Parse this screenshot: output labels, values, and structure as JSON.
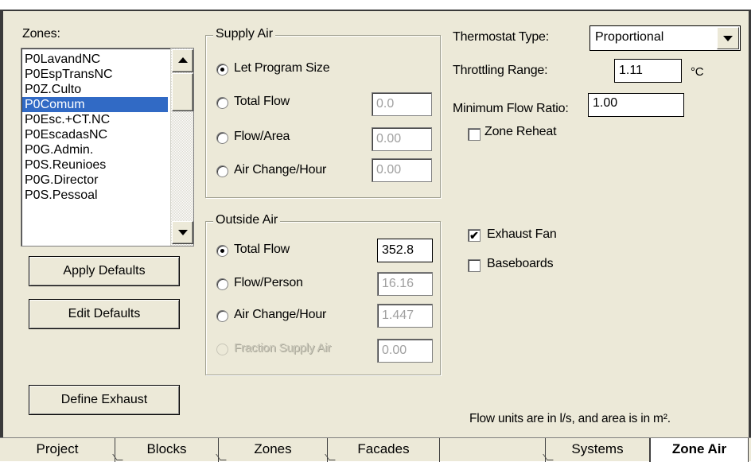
{
  "zones": {
    "label": "Zones:",
    "items": [
      "P0LavandNC",
      "P0EspTransNC",
      "P0Z.Culto",
      "P0Comum",
      "P0Esc.+CT.NC",
      "P0EscadasNC",
      "P0G.Admin.",
      "P0S.Reunioes",
      "P0G.Director",
      "P0S.Pessoal"
    ],
    "selected": "P0Comum"
  },
  "buttons": {
    "apply_defaults": "Apply Defaults",
    "edit_defaults": "Edit Defaults",
    "define_exhaust": "Define Exhaust"
  },
  "supply_air": {
    "title": "Supply Air",
    "let_program_size": "Let Program Size",
    "total_flow": "Total Flow",
    "total_flow_value": "0.0",
    "flow_area": "Flow/Area",
    "flow_area_value": "0.00",
    "air_change": "Air Change/Hour",
    "air_change_value": "0.00",
    "selected": "Let Program Size"
  },
  "outside_air": {
    "title": "Outside Air",
    "total_flow": "Total Flow",
    "total_flow_value": "352.8",
    "flow_person": "Flow/Person",
    "flow_person_value": "16.16",
    "air_change": "Air Change/Hour",
    "air_change_value": "1.447",
    "fraction_supply": "Fraction Supply Air",
    "fraction_supply_value": "0.00",
    "selected": "Total Flow"
  },
  "thermostat": {
    "type_label": "Thermostat Type:",
    "type_value": "Proportional",
    "throttling_label": "Throttling Range:",
    "throttling_value": "1.11",
    "throttling_unit": "°C",
    "min_flow_label": "Minimum Flow Ratio:",
    "min_flow_value": "1.00"
  },
  "options": {
    "zone_reheat": "Zone Reheat",
    "zone_reheat_checked": false,
    "exhaust_fan": "Exhaust Fan",
    "exhaust_fan_checked": true,
    "baseboards": "Baseboards",
    "baseboards_checked": false
  },
  "units_note": "Flow units are in l/s, and area is in m².",
  "tabs": [
    "Project",
    "Blocks",
    "Zones",
    "Facades",
    "",
    "Systems",
    "Zone Air"
  ],
  "active_tab": "Zone Air",
  "icons": {
    "checkmark": "✔"
  }
}
